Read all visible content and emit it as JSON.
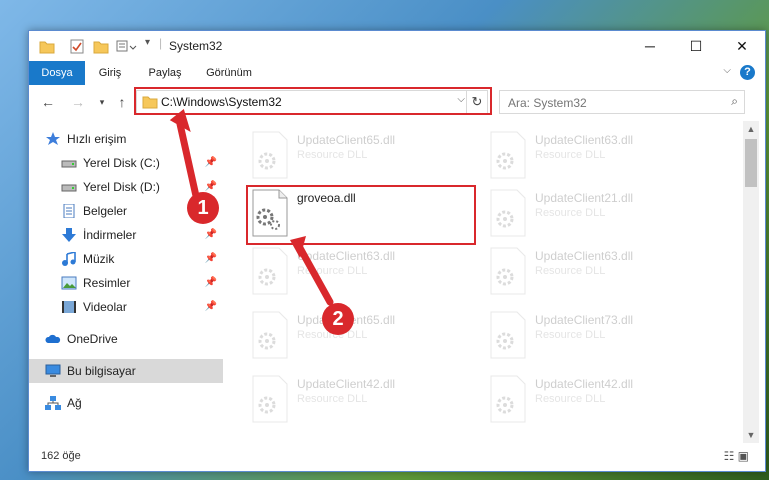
{
  "window": {
    "title": "System32",
    "minimize": "─",
    "maximize": "☐",
    "close": "✕"
  },
  "ribbon": {
    "tabs": [
      "Dosya",
      "Giriş",
      "Paylaş",
      "Görünüm"
    ],
    "help": "?"
  },
  "navigation": {
    "address": "C:\\Windows\\System32",
    "search_placeholder": "Ara: System32"
  },
  "sidebar": {
    "items": [
      {
        "label": "Hızlı erişim",
        "icon": "star-icon"
      },
      {
        "label": "Yerel Disk (C:)",
        "icon": "drive-icon",
        "pinned": true
      },
      {
        "label": "Yerel Disk (D:)",
        "icon": "drive-icon",
        "pinned": true
      },
      {
        "label": "Belgeler",
        "icon": "documents-icon",
        "pinned": true
      },
      {
        "label": "İndirmeler",
        "icon": "download-icon",
        "pinned": true
      },
      {
        "label": "Müzik",
        "icon": "music-icon",
        "pinned": true
      },
      {
        "label": "Resimler",
        "icon": "pictures-icon",
        "pinned": true
      },
      {
        "label": "Videolar",
        "icon": "videos-icon",
        "pinned": true
      },
      {
        "label": "OneDrive",
        "icon": "cloud-icon"
      },
      {
        "label": "Bu bilgisayar",
        "icon": "computer-icon",
        "selected": true
      },
      {
        "label": "Ağ",
        "icon": "network-icon"
      }
    ]
  },
  "files": [
    {
      "name": "UpdateClient65.dll",
      "desc": "Resource DLL",
      "faded": true
    },
    {
      "name": "UpdateClient63.dll",
      "desc": "Resource DLL",
      "faded": true
    },
    {
      "name": "groveoa.dll",
      "desc": "",
      "faded": false
    },
    {
      "name": "UpdateClient21.dll",
      "desc": "Resource DLL",
      "faded": true
    },
    {
      "name": "UpdateClient63.dll",
      "desc": "Resource DLL",
      "faded": true
    },
    {
      "name": "UpdateClient63.dll",
      "desc": "Resource DLL",
      "faded": true
    },
    {
      "name": "UpdateClient65.dll",
      "desc": "Resource DLL",
      "faded": true
    },
    {
      "name": "UpdateClient73.dll",
      "desc": "Resource DLL",
      "faded": true
    },
    {
      "name": "UpdateClient42.dll",
      "desc": "Resource DLL",
      "faded": true
    },
    {
      "name": "UpdateClient42.dll",
      "desc": "Resource DLL",
      "faded": true
    }
  ],
  "status": {
    "count": "162 öğe"
  },
  "annotations": {
    "step1": "1",
    "step2": "2",
    "color": "#d9282c"
  }
}
